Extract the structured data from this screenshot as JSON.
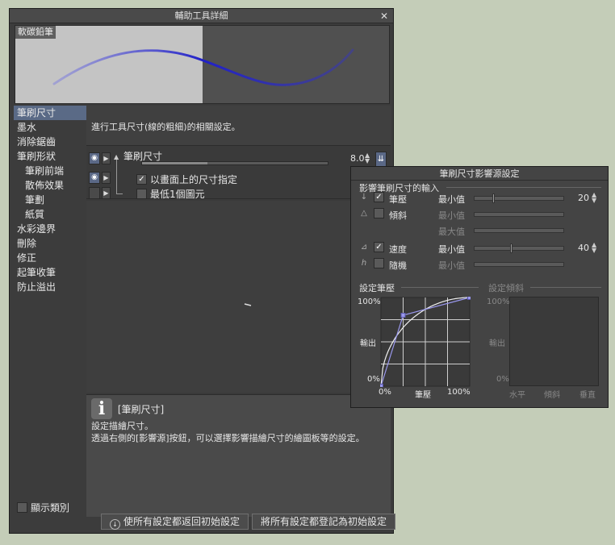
{
  "dialog": {
    "title": "輔助工具詳細",
    "close_glyph": "✕"
  },
  "preview": {
    "tool_name": "軟碳鉛筆"
  },
  "sidebar": {
    "items": [
      {
        "label": "筆刷尺寸",
        "sub": false,
        "active": true
      },
      {
        "label": "墨水",
        "sub": false,
        "active": false
      },
      {
        "label": "消除鋸齒",
        "sub": false,
        "active": false
      },
      {
        "label": "筆刷形狀",
        "sub": false,
        "active": false
      },
      {
        "label": "筆刷前端",
        "sub": true,
        "active": false
      },
      {
        "label": "散佈效果",
        "sub": true,
        "active": false
      },
      {
        "label": "筆劃",
        "sub": true,
        "active": false
      },
      {
        "label": "紙質",
        "sub": true,
        "active": false
      },
      {
        "label": "水彩邊界",
        "sub": false,
        "active": false
      },
      {
        "label": "刪除",
        "sub": false,
        "active": false
      },
      {
        "label": "修正",
        "sub": false,
        "active": false
      },
      {
        "label": "起筆收筆",
        "sub": false,
        "active": false
      },
      {
        "label": "防止溢出",
        "sub": false,
        "active": false
      }
    ],
    "show_category_label": "顯示類別"
  },
  "main": {
    "description": "進行工具尺寸(線的粗細)的相關設定。",
    "brush_size_label": "筆刷尺寸",
    "brush_size_value": "8.0",
    "brush_size_fraction": 0.35,
    "specify_on_screen_label": "以畫面上的尺寸指定",
    "min_1px_label": "最低1個圖元"
  },
  "help": {
    "title": "[筆刷尺寸]",
    "line1": "設定描繪尺寸。",
    "line2": "透過右側的[影響源]按鈕，可以選擇影響描繪尺寸的繪圖板等的設定。"
  },
  "buttons": {
    "reset_all": "使所有設定都返回初始設定",
    "register_all": "將所有設定都登記為初始設定"
  },
  "popup": {
    "title": "筆刷尺寸影響源設定",
    "input_section": "影響筆刷尺寸的輸入",
    "rows": [
      {
        "icon": "↓",
        "label": "筆壓",
        "checked": true,
        "mm": "最小值",
        "value": "20",
        "fraction": 0.2,
        "enabled": true
      },
      {
        "icon": "△",
        "label": "傾斜",
        "checked": false,
        "mm": "最小值",
        "value": "",
        "fraction": 0,
        "enabled": false
      },
      {
        "icon": "",
        "label": "",
        "checked": false,
        "mm": "最大值",
        "value": "",
        "fraction": 0,
        "enabled": false
      },
      {
        "icon": "⊿",
        "label": "速度",
        "checked": true,
        "mm": "最小值",
        "value": "40",
        "fraction": 0.4,
        "enabled": true
      },
      {
        "icon": "ℎ",
        "label": "隨機",
        "checked": false,
        "mm": "最小值",
        "value": "",
        "fraction": 0,
        "enabled": false
      }
    ],
    "pressure_graph": {
      "header": "設定筆壓",
      "y_top": "100%",
      "y_bottom": "0%",
      "y_label": "輸出",
      "x_left": "0%",
      "x_mid": "筆壓",
      "x_right": "100%",
      "points": [
        [
          0,
          0
        ],
        [
          0.25,
          0.8
        ],
        [
          1,
          1
        ]
      ]
    },
    "tilt_graph": {
      "header": "設定傾斜",
      "y_top": "100%",
      "y_bottom": "0%",
      "y_label": "輸出",
      "x_left": "水平",
      "x_mid": "傾斜",
      "x_right": "垂直"
    }
  }
}
